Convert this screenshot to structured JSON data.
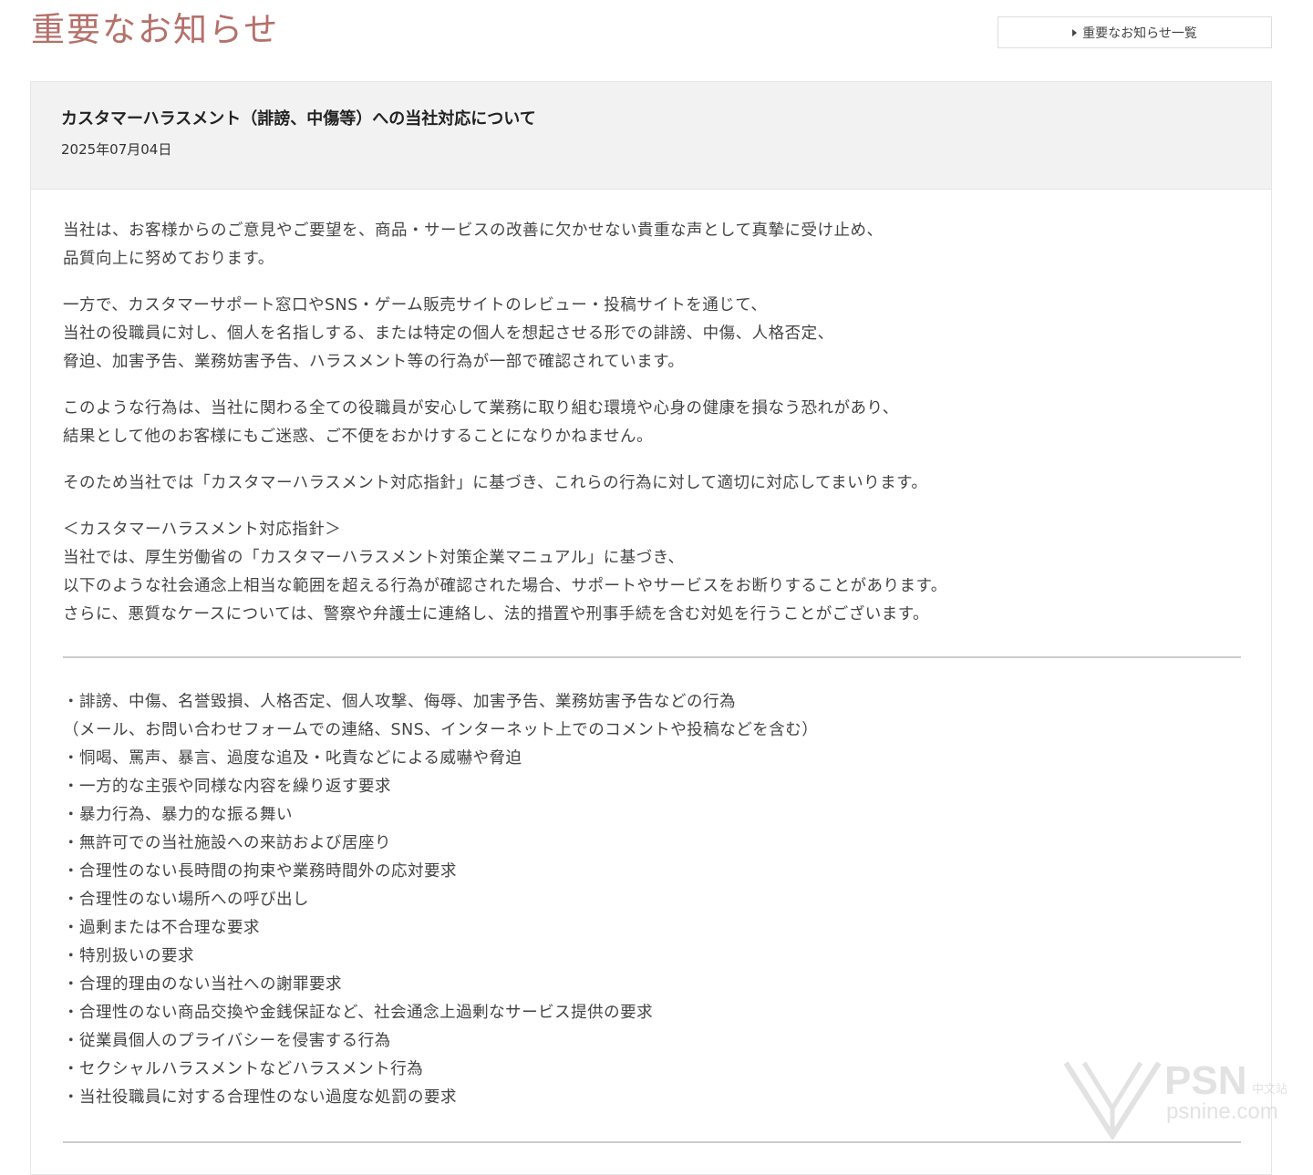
{
  "header": {
    "page_title": "重要なお知らせ",
    "list_link_label": "重要なお知らせ一覧"
  },
  "article": {
    "title": "カスタマーハラスメント（誹謗、中傷等）への当社対応について",
    "date": "2025年07月04日",
    "paragraphs": [
      [
        "当社は、お客様からのご意見やご要望を、商品・サービスの改善に欠かせない貴重な声として真摯に受け止め、",
        "品質向上に努めております。"
      ],
      [
        "一方で、カスタマーサポート窓口やSNS・ゲーム販売サイトのレビュー・投稿サイトを通じて、",
        "当社の役職員に対し、個人を名指しする、または特定の個人を想起させる形での誹謗、中傷、人格否定、",
        "脅迫、加害予告、業務妨害予告、ハラスメント等の行為が一部で確認されています。"
      ],
      [
        "このような行為は、当社に関わる全ての役職員が安心して業務に取り組む環境や心身の健康を損なう恐れがあり、",
        "結果として他のお客様にもご迷惑、ご不便をおかけすることになりかねません。"
      ],
      [
        "そのため当社では「カスタマーハラスメント対応指針」に基づき、これらの行為に対して適切に対応してまいります。"
      ]
    ],
    "policy_lines": [
      "＜カスタマーハラスメント対応指針＞",
      "当社では、厚生労働省の「カスタマーハラスメント対策企業マニュアル」に基づき、",
      "以下のような社会通念上相当な範囲を超える行為が確認された場合、サポートやサービスをお断りすることがあります。",
      "さらに、悪質なケースについては、警察や弁護士に連絡し、法的措置や刑事手続を含む対処を行うことがございます。"
    ],
    "bullets": [
      "・誹謗、中傷、名誉毀損、人格否定、個人攻撃、侮辱、加害予告、業務妨害予告などの行為",
      "（メール、お問い合わせフォームでの連絡、SNS、インターネット上でのコメントや投稿などを含む）",
      "・恫喝、罵声、暴言、過度な追及・叱責などによる威嚇や脅迫",
      "・一方的な主張や同様な内容を繰り返す要求",
      "・暴力行為、暴力的な振る舞い",
      "・無許可での当社施設への来訪および居座り",
      "・合理性のない長時間の拘束や業務時間外の応対要求",
      "・合理性のない場所への呼び出し",
      "・過剰または不合理な要求",
      "・特別扱いの要求",
      "・合理的理由のない当社への謝罪要求",
      "・合理性のない商品交換や金銭保証など、社会通念上過剰なサービス提供の要求",
      "・従業員個人のプライバシーを侵害する行為",
      "・セクシャルハラスメントなどハラスメント行為",
      "・当社役職員に対する合理性のない過度な処罰の要求"
    ]
  },
  "watermark": {
    "brand": "PSN",
    "suffix": "中文站",
    "url": "psnine.com"
  }
}
